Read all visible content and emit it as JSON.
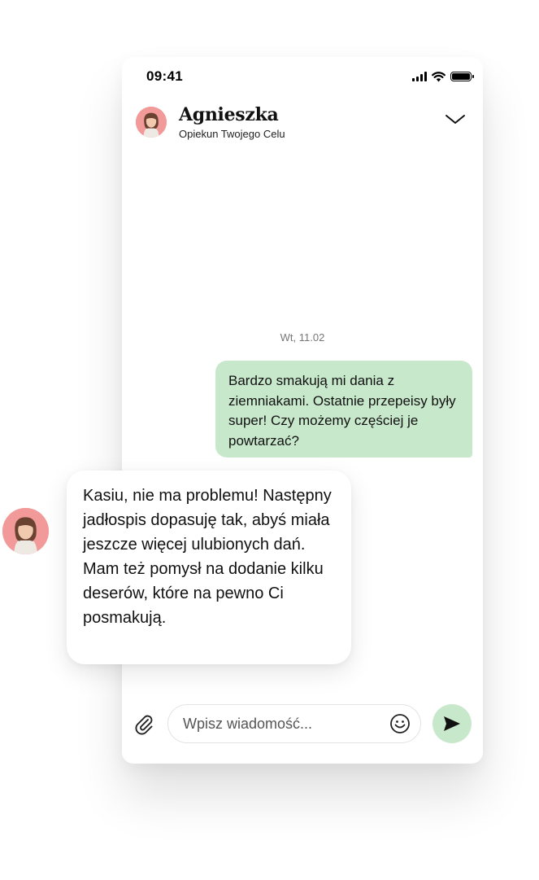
{
  "status": {
    "time": "09:41"
  },
  "header": {
    "name": "Agnieszka",
    "role": "Opiekun Twojego Celu",
    "avatar_color": "#f29a9a"
  },
  "chat": {
    "date": "Wt, 11.02",
    "messages": [
      {
        "direction": "outgoing",
        "text": "Bardzo smakują mi dania z ziemniakami. Ostatnie przepeisy były super! Czy możemy częściej je powtarzać?"
      },
      {
        "direction": "incoming",
        "text": "Kasiu, nie ma problemu! Następny jadłospis dopasuję tak, abyś miała jeszcze więcej ulubionych dań. Mam też pomysł na dodanie kilku deserów, które na pewno Ci posmakują."
      }
    ]
  },
  "composer": {
    "placeholder": "Wpisz wiadomość...",
    "value": ""
  },
  "colors": {
    "outgoing_bubble": "#c8e8cc",
    "send_button": "#c8e8cc"
  },
  "icons": [
    "signal-icon",
    "wifi-icon",
    "battery-icon",
    "chevron-down-icon",
    "paperclip-icon",
    "emoji-icon",
    "send-icon"
  ]
}
